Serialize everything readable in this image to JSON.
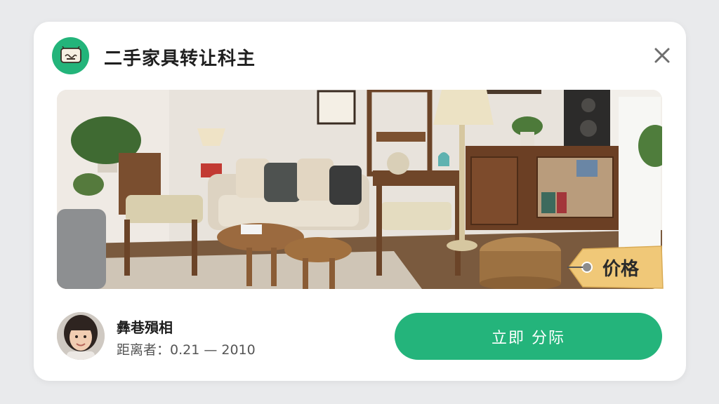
{
  "dialog": {
    "title": "二手家具转让科主",
    "close_icon": "close-icon",
    "app_icon": "chat-bubble-icon"
  },
  "listing": {
    "image_description_icon": "furniture-photo",
    "price_tag_label": "价格"
  },
  "seller": {
    "name": "彝巷殞相",
    "distance": "距离者：0.21 — 2010"
  },
  "cta": {
    "label": "立即  分际"
  },
  "colors": {
    "accent": "#24b47b",
    "tag": "#f0c878",
    "background": "#e9eaec"
  }
}
